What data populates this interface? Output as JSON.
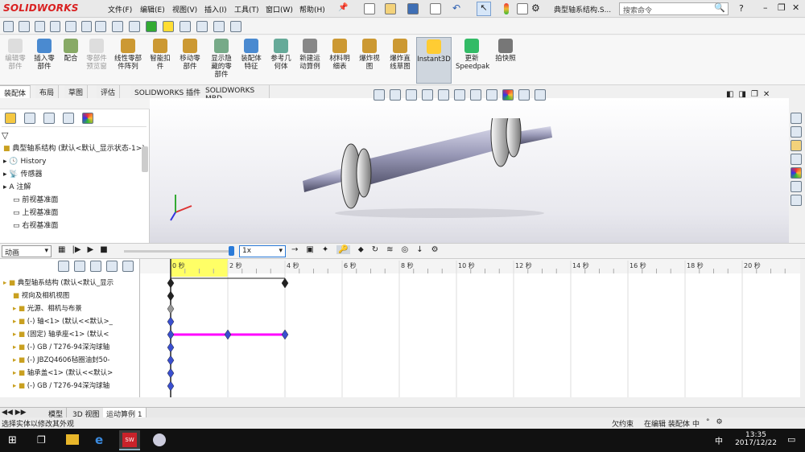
{
  "app": {
    "logo": "SOLIDWORKS",
    "doc_title": "典型轴系结构.S...",
    "search_placeholder": "搜索命令"
  },
  "menu": [
    "文件(F)",
    "编辑(E)",
    "视图(V)",
    "插入(I)",
    "工具(T)",
    "窗口(W)",
    "帮助(H)"
  ],
  "ribbon": [
    {
      "label": "编辑零\n部件",
      "disabled": true
    },
    {
      "label": "插入零\n部件",
      "disabled": false
    },
    {
      "label": "配合",
      "disabled": false
    },
    {
      "label": "零部件\n预览窗",
      "disabled": true
    },
    {
      "label": "线性零部\n件阵列",
      "disabled": false
    },
    {
      "label": "智能扣\n件",
      "disabled": false
    },
    {
      "label": "移动零\n部件",
      "disabled": false
    },
    {
      "label": "显示隐\n藏的零\n部件",
      "disabled": false
    },
    {
      "label": "装配体\n特征",
      "disabled": false
    },
    {
      "label": "参考几\n何体",
      "disabled": false
    },
    {
      "label": "新建运\n动算例",
      "disabled": false
    },
    {
      "label": "材料明\n细表",
      "disabled": false
    },
    {
      "label": "爆炸视\n图",
      "disabled": false
    },
    {
      "label": "爆炸直\n线草图",
      "disabled": false
    },
    {
      "label": "Instant3D",
      "disabled": false,
      "active": true
    },
    {
      "label": "更新\nSpeedpak",
      "disabled": false
    },
    {
      "label": "拍快照",
      "disabled": false
    }
  ],
  "tabs": [
    "装配体",
    "布局",
    "草图",
    "评估",
    "SOLIDWORKS 插件",
    "SOLIDWORKS MBD"
  ],
  "feature_tree": {
    "root": "典型轴系结构 (默认<默认_显示状态-1>)",
    "items": [
      "History",
      "传感器",
      "注解",
      "前视基准面",
      "上视基准面",
      "右视基准面"
    ]
  },
  "motion": {
    "type": "动画",
    "speed": "1x"
  },
  "timeline": {
    "ticks": [
      "0 秒",
      "2 秒",
      "4 秒",
      "6 秒",
      "8 秒",
      "10 秒",
      "12 秒",
      "14 秒",
      "16 秒",
      "18 秒",
      "20 秒"
    ]
  },
  "motion_tree": [
    "典型轴系结构 (默认<默认_显示",
    "视向及相机视图",
    "光源、相机与布景",
    "(-) 轴<1> (默认<<默认>_",
    "(固定) 轴承座<1> (默认<",
    "(-) GB / T276-94深沟球轴",
    "(-) JBZQ4606毡圈油封50-",
    "轴承盖<1> (默认<<默认>",
    "(-) GB / T276-94深沟球轴"
  ],
  "bottom_tabs": [
    "模型",
    "3D 视图",
    "运动算例 1"
  ],
  "status": {
    "left": "选择实体以修改其外观",
    "right1": "欠约束",
    "right2": "在编辑 装配体"
  },
  "taskbar": {
    "time": "13:35",
    "date": "2017/12/22",
    "ime": "中"
  },
  "colors": {
    "accent": "#d92020",
    "key_blue": "#3a4fd0",
    "bar_magenta": "#ff00ff"
  }
}
